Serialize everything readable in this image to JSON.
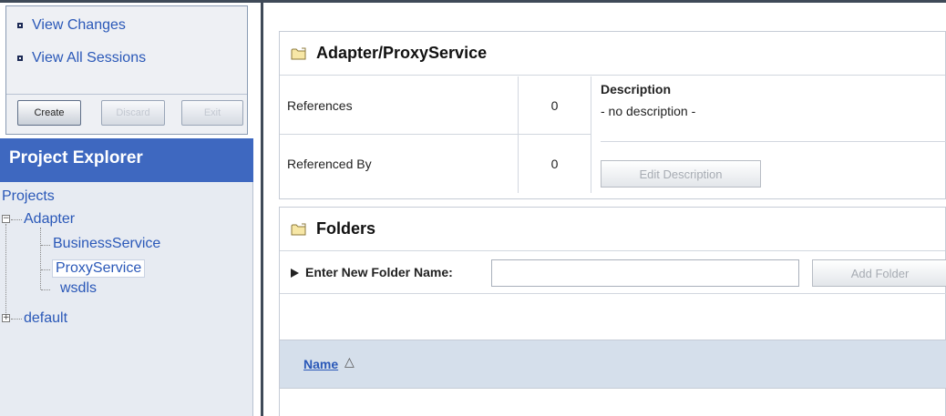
{
  "session": {
    "links": [
      "View Changes",
      "View All Sessions"
    ],
    "buttons": {
      "create": "Create",
      "discard": "Discard",
      "exit": "Exit"
    }
  },
  "explorer": {
    "title": "Project Explorer",
    "root": "Projects",
    "tree": {
      "adapter": "Adapter",
      "children": [
        "BusinessService",
        "ProxyService",
        "wsdls"
      ],
      "default": "default",
      "selected": "ProxyService"
    }
  },
  "resource": {
    "title": "Adapter/ProxyService",
    "references_label": "References",
    "references_value": "0",
    "referenced_by_label": "Referenced By",
    "referenced_by_value": "0",
    "description_title": "Description",
    "description_text": "- no description -",
    "edit_description_label": "Edit Description"
  },
  "folders": {
    "title": "Folders",
    "new_folder_label": "Enter New Folder Name:",
    "new_folder_value": "",
    "add_folder_label": "Add Folder",
    "column_name": "Name",
    "sort_symbol": "△"
  },
  "colors": {
    "explorer_header": "#3e68c0",
    "link": "#2a58b8",
    "table_header": "#d5dfeb"
  },
  "icons": {
    "folder": "folder-icon",
    "bullet": "square-bullet-icon",
    "expander": "tree-expander-icon",
    "arrow": "triangle-right-icon"
  }
}
